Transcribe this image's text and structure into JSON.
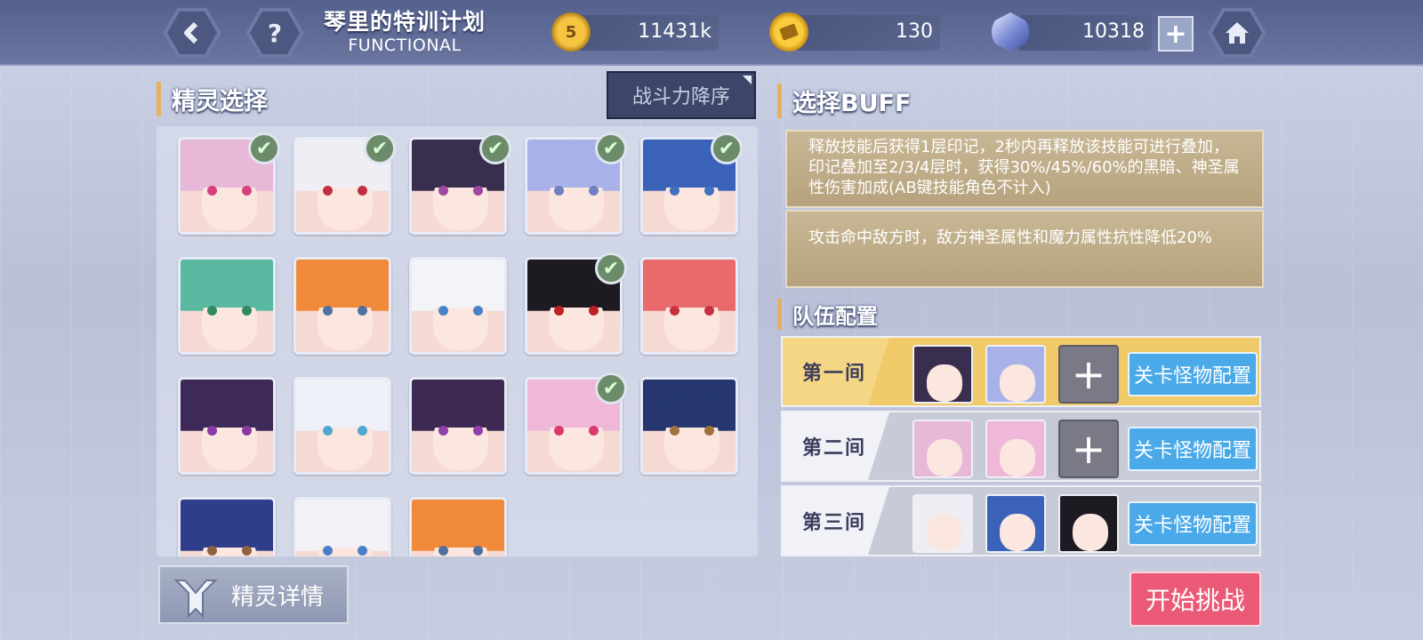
{
  "header": {
    "title": "琴里的特训计划",
    "subtitle": "FUNCTIONAL",
    "back_icon": "chevron-left-icon",
    "help_icon": "?",
    "home_icon": "home-icon"
  },
  "resources": {
    "gold": {
      "value": "11431k",
      "icon": "gold-coin-icon",
      "glyph": "5"
    },
    "token": {
      "value": "130",
      "icon": "token-coin-icon"
    },
    "crystal": {
      "value": "10318",
      "icon": "crystal-icon",
      "add_label": "+"
    }
  },
  "spirit_select": {
    "title": "精灵选择",
    "sort_label": "战斗力降序",
    "cards": [
      {
        "name": "spirit-1",
        "hair": "#e8b8d8",
        "eye": "#d8407a",
        "checked": true
      },
      {
        "name": "spirit-2",
        "hair": "#eeeef4",
        "eye": "#c03040",
        "checked": true
      },
      {
        "name": "spirit-3",
        "hair": "#3a2e4e",
        "eye": "#a048a0",
        "checked": true
      },
      {
        "name": "spirit-4",
        "hair": "#a8b2e8",
        "eye": "#7080c0",
        "checked": true
      },
      {
        "name": "spirit-5",
        "hair": "#3a62b8",
        "eye": "#4070c0",
        "checked": true
      },
      {
        "name": "spirit-6",
        "hair": "#58b8a0",
        "eye": "#2f8a60",
        "checked": false
      },
      {
        "name": "spirit-7",
        "hair": "#f08a3a",
        "eye": "#5070a0",
        "checked": false
      },
      {
        "name": "spirit-8",
        "hair": "#f2f4f8",
        "eye": "#4a80c8",
        "checked": false
      },
      {
        "name": "spirit-9",
        "hair": "#1e1a22",
        "eye": "#c02020",
        "checked": true
      },
      {
        "name": "spirit-10",
        "hair": "#e86a6a",
        "eye": "#c83040",
        "checked": false
      },
      {
        "name": "spirit-11",
        "hair": "#3e2a58",
        "eye": "#8a3aa0",
        "checked": false
      },
      {
        "name": "spirit-12",
        "hair": "#eef2f8",
        "eye": "#50a8d0",
        "checked": false
      },
      {
        "name": "spirit-13",
        "hair": "#3c2a52",
        "eye": "#9040a8",
        "checked": false
      },
      {
        "name": "spirit-14",
        "hair": "#f0b8d8",
        "eye": "#d83a70",
        "checked": true
      },
      {
        "name": "spirit-15",
        "hair": "#25376e",
        "eye": "#a07040",
        "checked": false
      },
      {
        "name": "spirit-16",
        "hair": "#2f3e88",
        "eye": "#906040",
        "checked": false
      },
      {
        "name": "spirit-17",
        "hair": "#f2f2f6",
        "eye": "#4a80c8",
        "checked": false
      },
      {
        "name": "spirit-18",
        "hair": "#f08a3a",
        "eye": "#5070a0",
        "checked": false
      }
    ],
    "check_glyph": "✔"
  },
  "buff": {
    "title": "选择BUFF",
    "items": [
      "释放技能后获得1层印记，2秒内再释放该技能可进行叠加，印记叠加至2/3/4层时，获得30%/45%/60%的黑暗、神圣属性伤害加成(AB键技能角色不计入)",
      "攻击命中敌方时，敌方神圣属性和魔力属性抗性降低20%"
    ]
  },
  "team": {
    "title": "队伍配置",
    "config_label": "关卡怪物配置",
    "add_glyph": "+",
    "rows": [
      {
        "label": "第一间",
        "members": [
          "#3a2e4e",
          "#a8b2e8"
        ],
        "has_add": true,
        "bg": "#f0c969"
      },
      {
        "label": "第二间",
        "members": [
          "#e8b8d8",
          "#f0b8d8"
        ],
        "has_add": true,
        "bg": "#c7cbd8"
      },
      {
        "label": "第三间",
        "members": [
          "#eeeef4",
          "#3a62b8",
          "#1e1a22"
        ],
        "has_add": false,
        "bg": "#c7cbd8"
      }
    ]
  },
  "footer": {
    "detail_label": "精灵详情",
    "detail_icon": "spirit-emblem-icon",
    "start_label": "开始挑战"
  },
  "colors": {
    "accent": "#e4b25a",
    "start": "#ea5a76",
    "config": "#4aa9e8"
  }
}
